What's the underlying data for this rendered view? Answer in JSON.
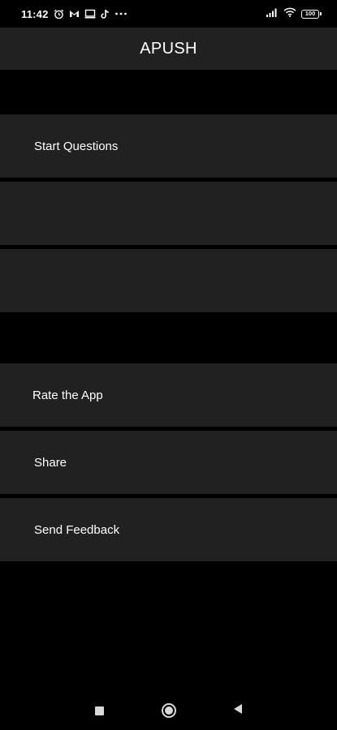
{
  "status_bar": {
    "time": "11:42",
    "left_icons": [
      "alarm-icon",
      "mail-app-icon",
      "screen-icon",
      "tiktok-icon",
      "more-icon"
    ],
    "right_icons": [
      "signal-icon",
      "wifi-icon",
      "battery-icon"
    ],
    "battery_level": "100"
  },
  "app_bar": {
    "title": "APUSH"
  },
  "menu": {
    "start_questions": "Start Questions",
    "rate_app": "Rate the App",
    "share": "Share",
    "send_feedback": "Send Feedback"
  },
  "nav_bar": {
    "icons": [
      "recent-apps-icon",
      "home-icon",
      "back-icon"
    ]
  },
  "colors": {
    "background": "#000000",
    "surface": "#212121",
    "text": "#ffffff"
  }
}
